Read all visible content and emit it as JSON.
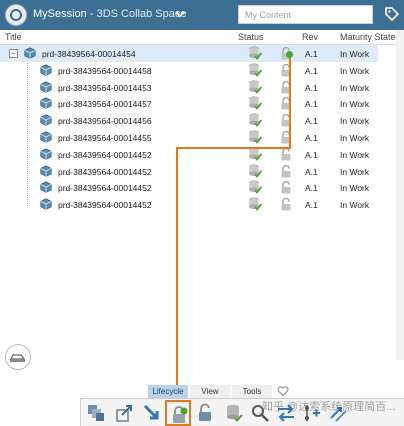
{
  "header": {
    "app_name": "MySession",
    "separator": " - ",
    "space_name": "3DS Collab Space",
    "search_placeholder": "My Content"
  },
  "columns": {
    "title": "Title",
    "status": "Status",
    "rev": "Rev",
    "maturity": "Maturity State"
  },
  "rows": [
    {
      "title": "prd-38439564-00014454",
      "rev": "A.1",
      "maturity": "In Work",
      "root": true
    },
    {
      "title": "prd-38439564-00014458",
      "rev": "A.1",
      "maturity": "In Work"
    },
    {
      "title": "prd-38439564-00014453",
      "rev": "A.1",
      "maturity": "In Work"
    },
    {
      "title": "prd-38439564-00014457",
      "rev": "A.1",
      "maturity": "In Work"
    },
    {
      "title": "prd-38439564-00014456",
      "rev": "A.1",
      "maturity": "In Work"
    },
    {
      "title": "prd-38439564-00014455",
      "rev": "A.1",
      "maturity": "In Work"
    },
    {
      "title": "prd-38439564-00014452",
      "rev": "A.1",
      "maturity": "In Work"
    },
    {
      "title": "prd-38439564-00014452",
      "rev": "A.1",
      "maturity": "In Work"
    },
    {
      "title": "prd-38439564-00014452",
      "rev": "A.1",
      "maturity": "In Work"
    },
    {
      "title": "prd-38439564-00014452",
      "rev": "A.1",
      "maturity": "In Work"
    }
  ],
  "tabs": [
    {
      "label": "Lifecycle",
      "active": true
    },
    {
      "label": "View",
      "active": false
    },
    {
      "label": "Tools",
      "active": false
    }
  ],
  "toolbar_icons": [
    "copy-structure-icon",
    "share-icon",
    "collapse-icon",
    "lock-add-icon",
    "unlock-icon",
    "database-icon",
    "search-zoom-icon",
    "transfer-icon",
    "add-link-icon",
    "arrows-icon"
  ],
  "watermark": "知乎 @达索系统原理简百...",
  "colors": {
    "header": "#3d6f94",
    "selected_row": "#dcebf7",
    "annotation": "#e07a1a",
    "status_green": "#4aa52e"
  }
}
